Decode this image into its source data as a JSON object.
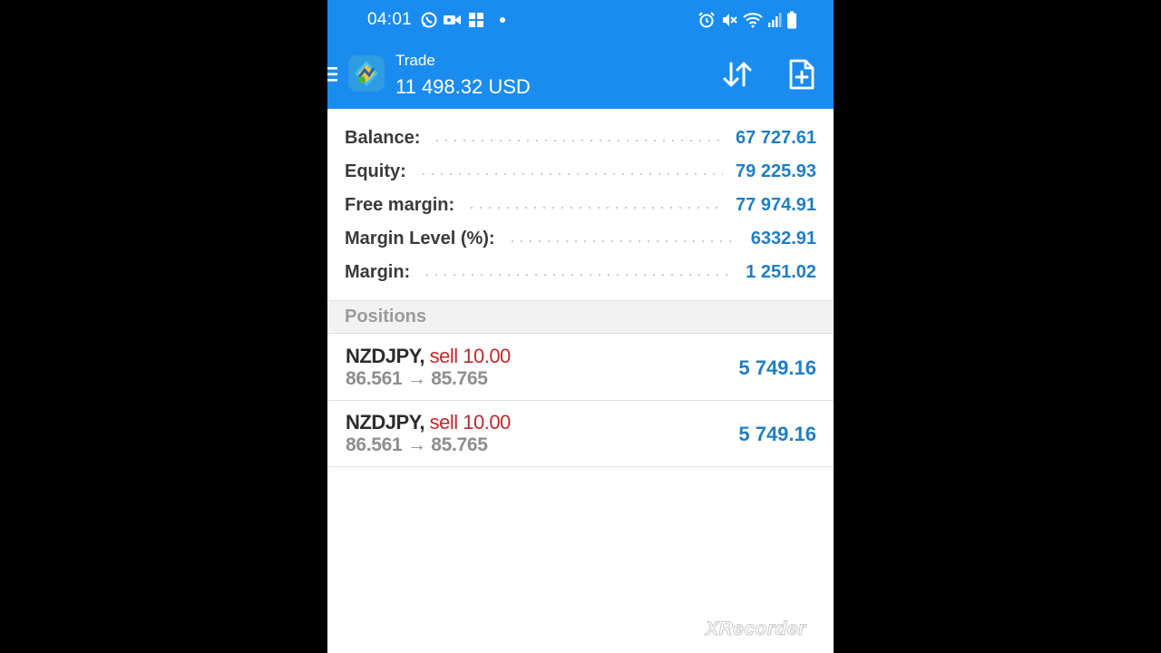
{
  "status_bar": {
    "time": "04:01",
    "left_icons": [
      "whatsapp-icon",
      "video-camera-icon",
      "gallery-icon",
      "notification-dot-icon"
    ],
    "right_icons": [
      "alarm-icon",
      "mute-icon",
      "wifi-icon",
      "signal-icon",
      "battery-icon"
    ]
  },
  "app_bar": {
    "title": "Trade",
    "subtitle": "11 498.32 USD",
    "icons": [
      "menu-icon",
      "app-logo-icon",
      "sort-arrows-icon",
      "new-order-icon"
    ]
  },
  "summary": [
    {
      "label": "Balance:",
      "value": "67 727.61"
    },
    {
      "label": "Equity:",
      "value": "79 225.93"
    },
    {
      "label": "Free margin:",
      "value": "77 974.91"
    },
    {
      "label": "Margin Level (%):",
      "value": "6332.91"
    },
    {
      "label": "Margin:",
      "value": "1 251.02"
    }
  ],
  "positions": {
    "header": "Positions",
    "items": [
      {
        "symbol": "NZDJPY",
        "comma": ",",
        "side": "sell 10.00",
        "prices": "86.561 → 85.765",
        "profit": "5 749.16"
      },
      {
        "symbol": "NZDJPY",
        "comma": ",",
        "side": "sell 10.00",
        "prices": "86.561 → 85.765",
        "profit": "5 749.16"
      }
    ]
  },
  "watermark": "XRecorder",
  "colors": {
    "header_blue": "#1a8cf0",
    "value_blue": "#1f7ec4",
    "sell_red": "#c0282d",
    "label_dark": "#3a3a3a",
    "muted_gray": "#8e8e8e"
  }
}
